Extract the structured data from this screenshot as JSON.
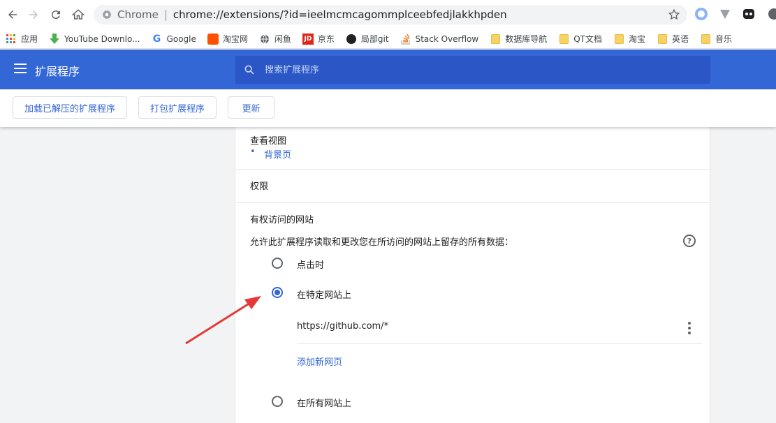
{
  "browser": {
    "url_scheme_label": "Chrome",
    "url": "chrome://extensions/?id=ieelmcmcagommplceebfedjlakkhpden"
  },
  "bookmarks": [
    {
      "label": "应用",
      "icon": "apps-grid-icon"
    },
    {
      "label": "YouTube Downlo...",
      "icon": "download-arrow-icon"
    },
    {
      "label": "Google",
      "icon": "google-icon"
    },
    {
      "label": "淘宝网",
      "icon": "taobao-icon"
    },
    {
      "label": "闲鱼",
      "icon": "globe-icon"
    },
    {
      "label": "京东",
      "icon": "jd-icon"
    },
    {
      "label": "局部git",
      "icon": "github-icon"
    },
    {
      "label": "Stack Overflow",
      "icon": "stackoverflow-icon"
    },
    {
      "label": "数据库导航",
      "icon": "folder-icon"
    },
    {
      "label": "QT文档",
      "icon": "folder-icon"
    },
    {
      "label": "淘宝",
      "icon": "folder-icon"
    },
    {
      "label": "英语",
      "icon": "folder-icon"
    },
    {
      "label": "音乐",
      "icon": "folder-icon"
    }
  ],
  "header": {
    "title": "扩展程序",
    "search_placeholder": "搜索扩展程序"
  },
  "actions": {
    "load_unpacked": "加载已解压的扩展程序",
    "pack": "打包扩展程序",
    "update": "更新"
  },
  "details": {
    "inspect_views_label": "查看视图",
    "background_page_link": "背景页",
    "permissions_label": "权限",
    "site_access_title": "有权访问的网站",
    "site_access_desc": "允许此扩展程序读取和更改您在所访问的网站上留存的所有数据：",
    "options": {
      "on_click": "点击时",
      "on_specific_sites": "在特定网站上",
      "on_all_sites": "在所有网站上"
    },
    "selected_option": "on_specific_sites",
    "site_entry": "https://github.com/*",
    "add_site_link": "添加新网页"
  },
  "colors": {
    "header_blue": "#3367d6",
    "search_blue": "#2a56c6",
    "link_blue": "#3367d6",
    "annotation_red": "#e53935"
  }
}
